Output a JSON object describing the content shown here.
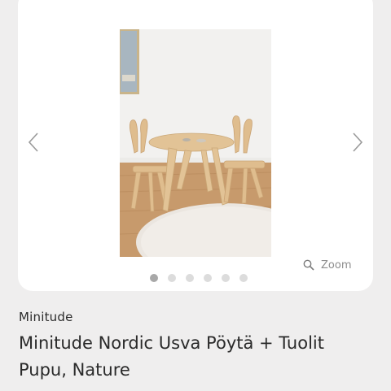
{
  "gallery": {
    "prev_icon": "chevron-left-icon",
    "next_icon": "chevron-right-icon",
    "image_alt": "Minitude Nordic Usva Pöytä + Tuolit Pupu, Nature",
    "zoom_label": "Zoom",
    "zoom_icon": "magnifier-icon",
    "dots_total": 6,
    "active_dot": 0
  },
  "product": {
    "brand": "Minitude",
    "title": "Minitude Nordic Usva Pöytä + Tuolit Pupu, Nature"
  },
  "colors": {
    "page_background": "#efeeee",
    "card_background": "#ffffff",
    "text": "#2a2a2a",
    "muted": "#8d8d8d",
    "dot_active": "#a8a8a8",
    "dot_inactive": "#dcdcdc"
  }
}
